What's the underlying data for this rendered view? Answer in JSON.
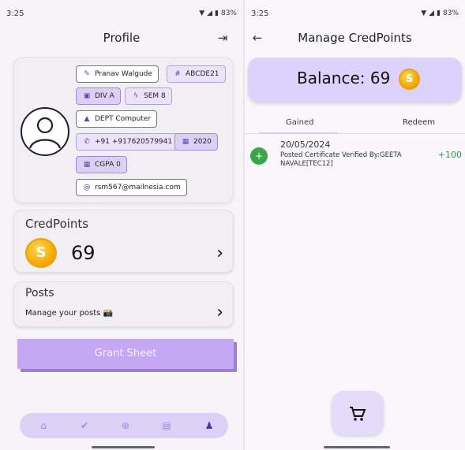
{
  "left": {
    "status": {
      "time": "3:25",
      "battery": "83%"
    },
    "header": {
      "title": "Profile",
      "logout_icon": "logout-icon"
    },
    "profile": {
      "name": "Pranav Walgude",
      "id": "ABCDE21",
      "division": "DIV A",
      "semester": "SEM 8",
      "department": "DEPT Computer",
      "phone": "+91 +917620579941",
      "year": "2020",
      "cgpa": "CGPA 0",
      "email": "rsm567@mailnesia.com"
    },
    "credpoints": {
      "label": "CredPoints",
      "value": "69",
      "coin_symbol": "S"
    },
    "posts": {
      "title": "Posts",
      "subtitle": "Manage your posts 📸"
    },
    "grant_button": "Grant Sheet",
    "nav": [
      "home-icon",
      "check-icon",
      "add-icon",
      "card-icon",
      "person-icon"
    ]
  },
  "right": {
    "status": {
      "time": "3:25",
      "battery": "83%"
    },
    "header": {
      "title": "Manage CredPoints",
      "back_icon": "back-arrow-icon"
    },
    "balance": {
      "text": "Balance: 69",
      "coin_symbol": "S"
    },
    "tabs": [
      "Gained",
      "Redeem"
    ],
    "transactions": [
      {
        "icon": "+",
        "date": "20/05/2024",
        "description": "Posted Certificate Verified By:GEETA NAVALE[TEC12]",
        "amount": "+100"
      }
    ],
    "fab_icon": "cart-icon"
  }
}
